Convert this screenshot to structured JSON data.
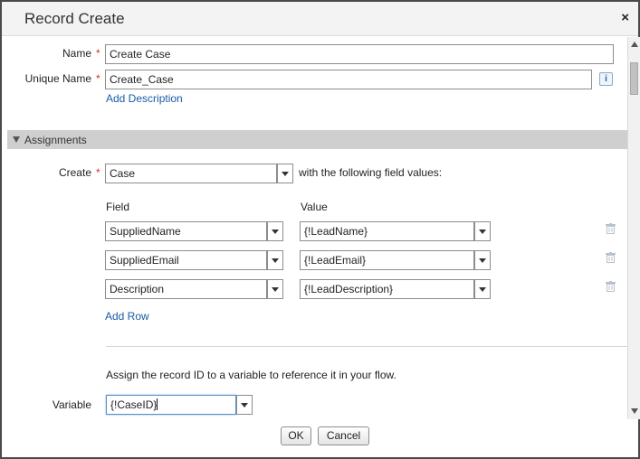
{
  "dialog": {
    "title": "Record Create",
    "close_glyph": "×",
    "close_icon": "close-icon"
  },
  "form": {
    "name_label": "Name",
    "name_value": "Create Case",
    "unique_name_label": "Unique Name",
    "unique_name_value": "Create_Case",
    "info_glyph": "i",
    "info_icon": "info-icon",
    "add_description": "Add Description",
    "required_marker": "*"
  },
  "assignments": {
    "section_title": "Assignments",
    "collapse_icon": "triangle-down-icon",
    "create_label": "Create",
    "create_value": "Case",
    "create_suffix": "with the following field values:",
    "field_header": "Field",
    "value_header": "Value",
    "rows": [
      {
        "field": "SuppliedName",
        "value": "{!LeadName}"
      },
      {
        "field": "SuppliedEmail",
        "value": "{!LeadEmail}"
      },
      {
        "field": "Description",
        "value": "{!LeadDescription}"
      }
    ],
    "delete_icon": "trash-icon",
    "add_row": "Add Row",
    "assign_text": "Assign the record ID to a variable to reference it in your flow.",
    "variable_label": "Variable",
    "variable_value": "{!CaseID}"
  },
  "footer": {
    "ok_label": "OK",
    "cancel_label": "Cancel"
  },
  "colors": {
    "required": "#c23934",
    "link": "#1a5ba6",
    "section_bar": "#cfcfcf"
  }
}
